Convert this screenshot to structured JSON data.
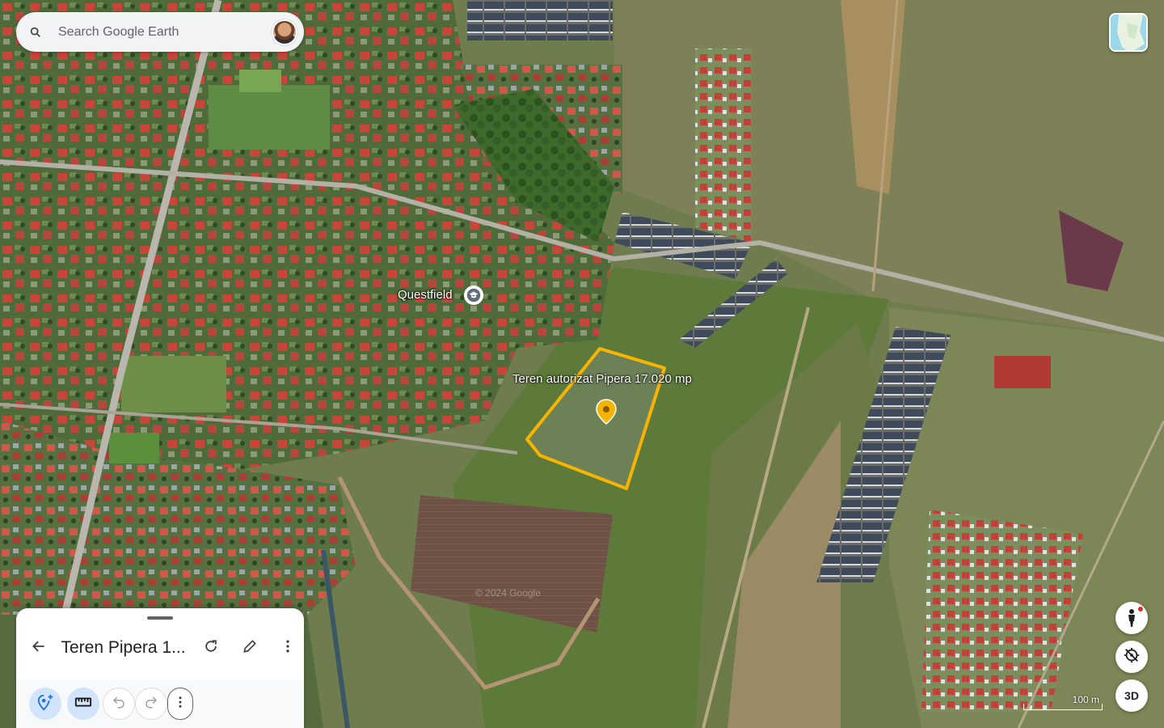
{
  "search": {
    "placeholder": "Search Google Earth"
  },
  "map": {
    "place_label": "Questfield",
    "polygon_label": "Teren autorizat Pipera 17.020 mp",
    "watermark": "© 2024 Google",
    "scale_label": "100 m",
    "colors": {
      "polygon_stroke": "#f9b400",
      "marker": "#f4b400"
    }
  },
  "controls": {
    "three_d_label": "3D"
  },
  "panel": {
    "title": "Teren Pipera 1..."
  },
  "icons": {
    "search": "search-icon",
    "back": "arrow-back-icon",
    "refresh": "refresh-icon",
    "edit": "pencil-icon",
    "more": "more-vert-icon",
    "add_placemark": "add-placemark-icon",
    "measure": "ruler-icon",
    "undo": "undo-icon",
    "redo": "redo-icon",
    "pegman": "pegman-icon",
    "compass": "compass-icon"
  }
}
